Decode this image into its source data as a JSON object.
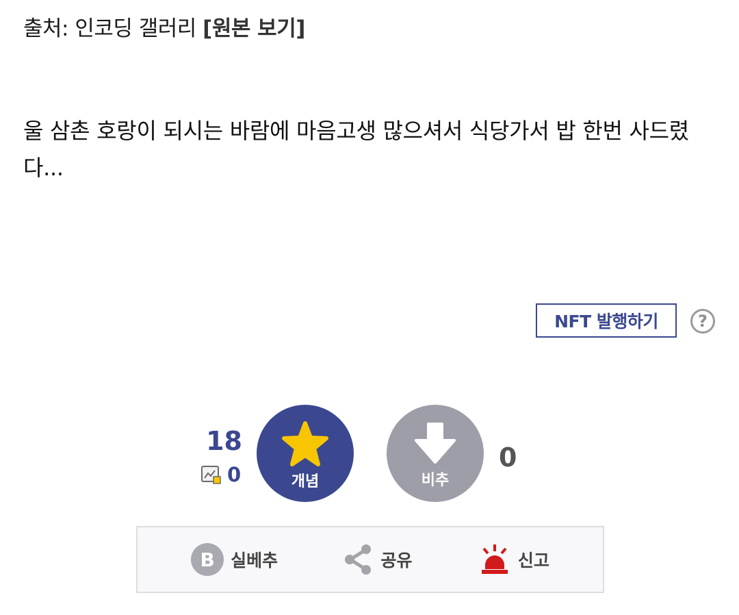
{
  "source": {
    "prefix": "출처: 인코딩 갤러리 ",
    "link_label": "[원본 보기]"
  },
  "post": {
    "body": "울 삼촌 호랑이 되시는 바람에 마음고생 많으셔서 식당가서 밥 한번 사드렸다..."
  },
  "nft": {
    "button_label": "NFT 발행하기",
    "help_glyph": "?"
  },
  "votes": {
    "up_count": "18",
    "fix_count": "0",
    "up_label": "개념",
    "down_label": "비추",
    "down_count": "0"
  },
  "actions": {
    "best_icon_letter": "B",
    "best_label": "실베추",
    "share_label": "공유",
    "report_label": "신고"
  },
  "colors": {
    "accent": "#3b4890",
    "down_gray": "#9e9ea8",
    "star_yellow": "#f7c600",
    "alarm_red": "#d11a1a"
  },
  "icons": [
    "help-icon",
    "fix-icon",
    "star-icon",
    "down-arrow-icon",
    "b-icon",
    "share-icon",
    "siren-icon"
  ]
}
